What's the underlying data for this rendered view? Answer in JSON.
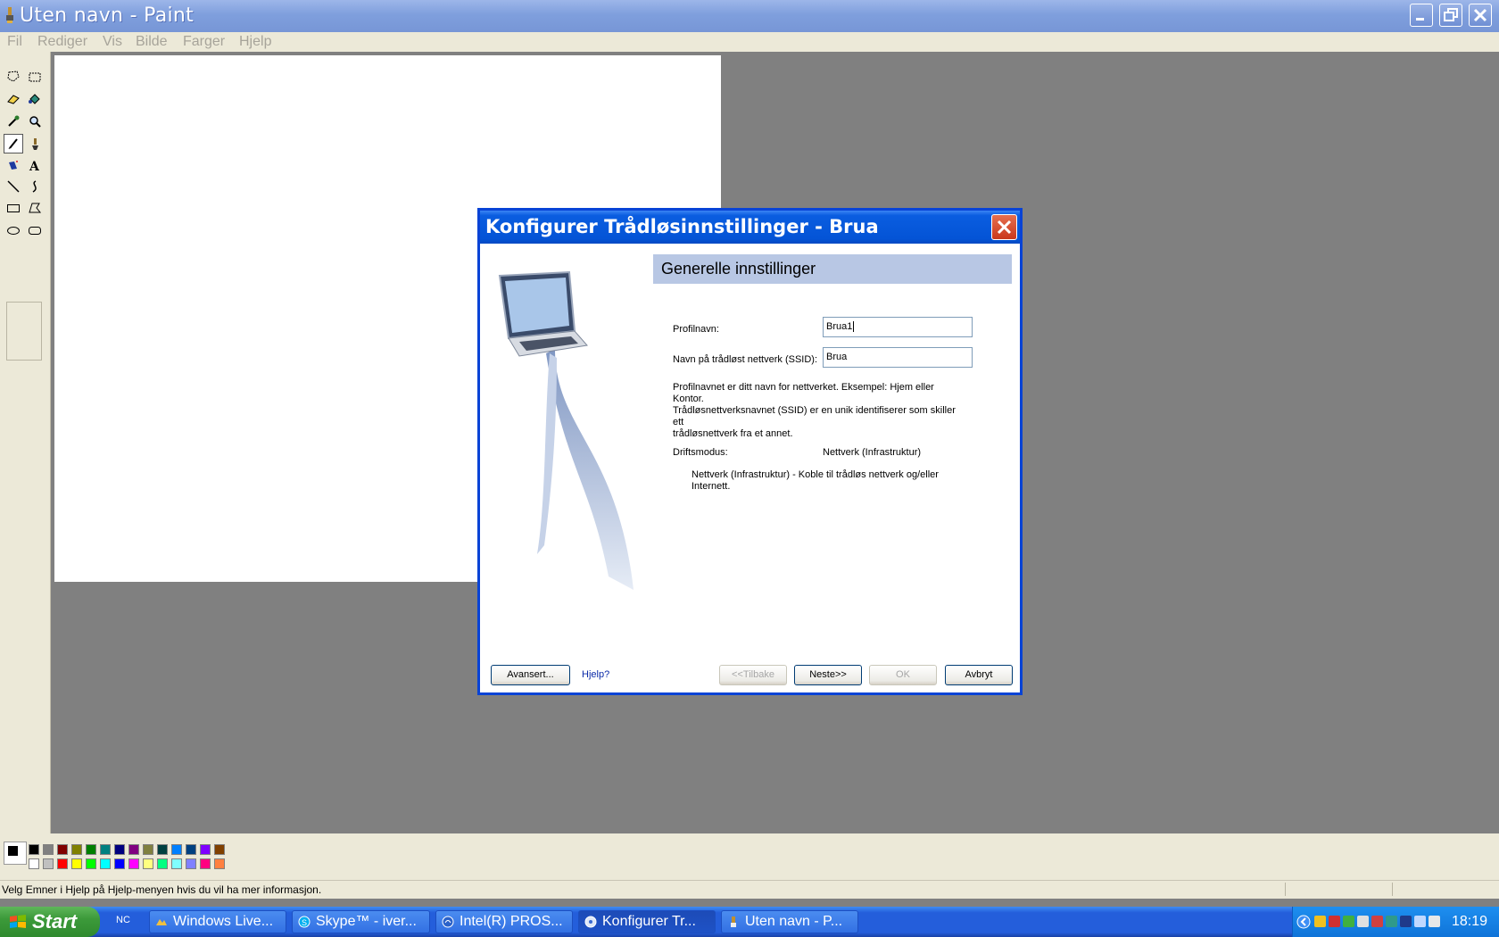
{
  "window": {
    "title": "Uten navn - Paint",
    "menu": [
      "Fil",
      "Rediger",
      "Vis",
      "Bilde",
      "Farger",
      "Hjelp"
    ]
  },
  "tools": [
    "free-select-icon",
    "select-icon",
    "eraser-icon",
    "fill-icon",
    "pick-color-icon",
    "magnifier-icon",
    "pencil-icon",
    "brush-icon",
    "airbrush-icon",
    "text-icon",
    "line-icon",
    "curve-icon",
    "rectangle-icon",
    "polygon-icon",
    "ellipse-icon",
    "rounded-rectangle-icon"
  ],
  "palette": {
    "foreground": "#000000",
    "background": "#ffffff",
    "row1": [
      "#000000",
      "#808080",
      "#800000",
      "#808000",
      "#008000",
      "#008080",
      "#000080",
      "#800080",
      "#808040",
      "#004040",
      "#0080ff",
      "#004080",
      "#8000ff",
      "#804000"
    ],
    "row2": [
      "#ffffff",
      "#c0c0c0",
      "#ff0000",
      "#ffff00",
      "#00ff00",
      "#00ffff",
      "#0000ff",
      "#ff00ff",
      "#ffff80",
      "#00ff80",
      "#80ffff",
      "#8080ff",
      "#ff0080",
      "#ff8040"
    ]
  },
  "status": {
    "text": "Velg Emner i Hjelp på Hjelp-menyen hvis du vil ha mer informasjon."
  },
  "taskbar": {
    "start": "Start",
    "quicklaunch": "NC",
    "tasks": [
      {
        "label": "Windows Live...",
        "icon": "windows-live-icon"
      },
      {
        "label": "Skype™ - iver...",
        "icon": "skype-icon"
      },
      {
        "label": "Intel(R) PROS...",
        "icon": "wireless-icon"
      },
      {
        "label": "Konfigurer Tr...",
        "icon": "wireless-config-icon"
      },
      {
        "label": "Uten navn - P...",
        "icon": "paint-icon"
      }
    ],
    "clock": "18:19"
  },
  "dialog": {
    "title": "Konfigurer Trådløsinnstillinger - Brua",
    "section": "Generelle innstillinger",
    "profile_label": "Profilnavn:",
    "profile_value": "Brua1",
    "ssid_label": "Navn på trådløst nettverk (SSID):",
    "ssid_value": "Brua",
    "description_lines": [
      "Profilnavnet er ditt navn for nettverket. Eksempel: Hjem eller Kontor.",
      "Trådløsnettverksnavnet (SSID) er en unik identifiserer som skiller ett",
      "trådløsnettverk fra et annet."
    ],
    "mode_label": "Driftsmodus:",
    "mode_value": "Nettverk (Infrastruktur)",
    "mode_desc_lines": [
      "Nettverk (Infrastruktur) - Koble til trådløs nettverk og/eller",
      "Internett."
    ],
    "buttons": {
      "advanced": "Avansert...",
      "help": "Hjelp?",
      "back": "<<Tilbake",
      "next": "Neste>>",
      "ok": "OK",
      "cancel": "Avbryt"
    }
  }
}
